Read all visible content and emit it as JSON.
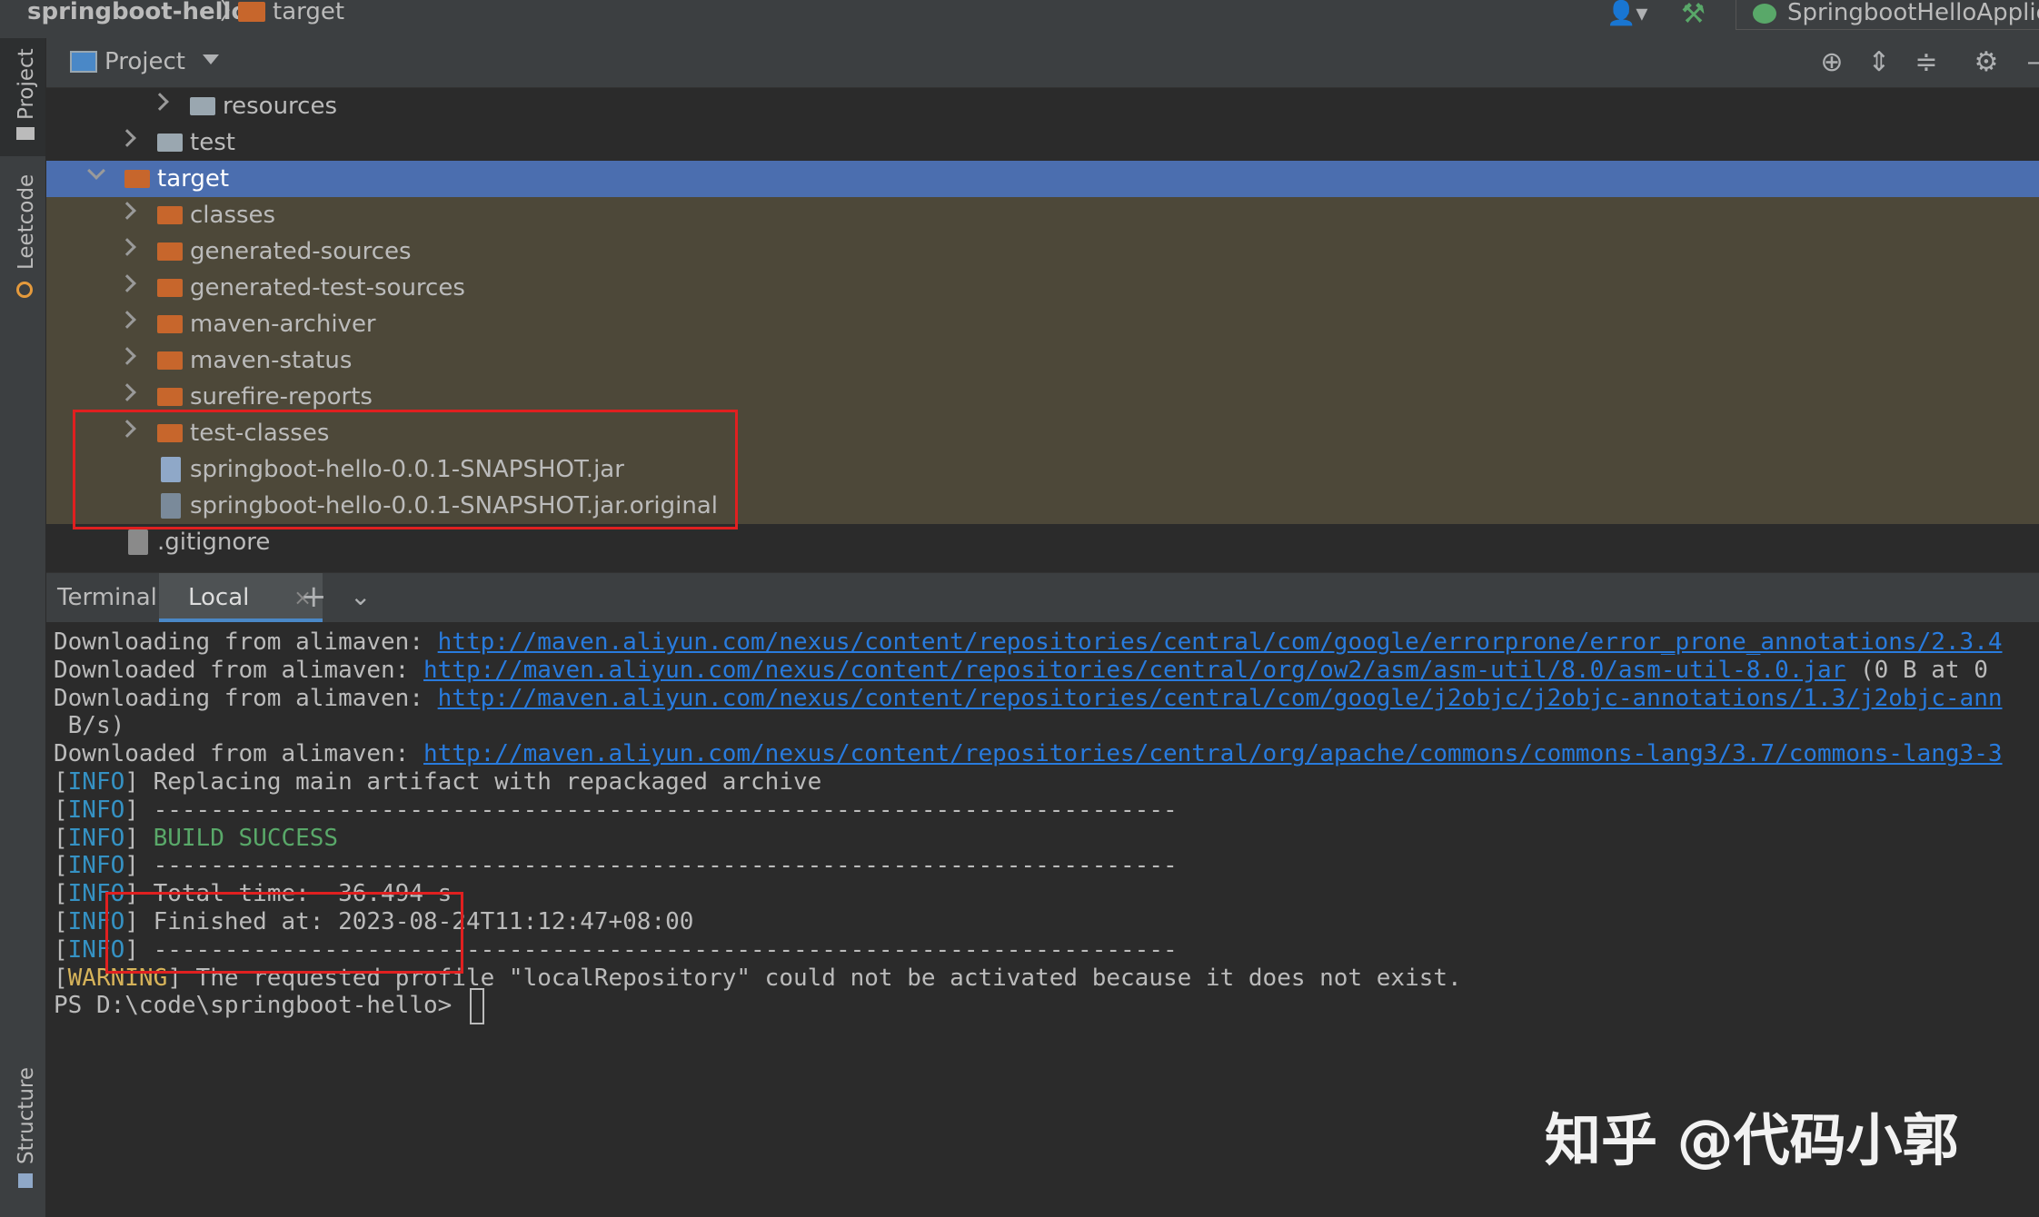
{
  "navbar": {
    "project_name": "springboot-hello",
    "separator": "〉",
    "current_folder": "target",
    "run_config": "SpringbootHelloApplicat"
  },
  "tool_strip": {
    "project": "Project",
    "leetcode": "Leetcode",
    "structure": "Structure"
  },
  "project_panel": {
    "title": "Project",
    "tree": [
      {
        "label": "resources"
      },
      {
        "label": "test"
      },
      {
        "label": "target"
      },
      {
        "label": "classes"
      },
      {
        "label": "generated-sources"
      },
      {
        "label": "generated-test-sources"
      },
      {
        "label": "maven-archiver"
      },
      {
        "label": "maven-status"
      },
      {
        "label": "surefire-reports"
      },
      {
        "label": "test-classes"
      },
      {
        "label": "springboot-hello-0.0.1-SNAPSHOT.jar"
      },
      {
        "label": "springboot-hello-0.0.1-SNAPSHOT.jar.original"
      },
      {
        "label": ".gitignore"
      }
    ]
  },
  "terminal": {
    "label": "Terminal:",
    "tab": "Local",
    "lines": [
      {
        "prefix": "Downloading from alimaven: ",
        "url": "http://maven.aliyun.com/nexus/content/repositories/central/com/google/errorprone/error_prone_annotations/2.3.4"
      },
      {
        "prefix": "Downloaded from alimaven: ",
        "url": "http://maven.aliyun.com/nexus/content/repositories/central/org/ow2/asm/asm-util/8.0/asm-util-8.0.jar",
        "suffix": " (0 B at 0"
      },
      {
        "prefix": "Downloading from alimaven: ",
        "url": "http://maven.aliyun.com/nexus/content/repositories/central/com/google/j2objc/j2objc-annotations/1.3/j2objc-ann"
      },
      {
        "text": " B/s)"
      },
      {
        "prefix": "Downloaded from alimaven: ",
        "url": "http://maven.aliyun.com/nexus/content/repositories/central/org/apache/commons/commons-lang3/3.7/commons-lang3-3"
      },
      {
        "tag": "INFO",
        "text": " Replacing main artifact with repackaged archive"
      },
      {
        "tag": "INFO",
        "text": " ------------------------------------------------------------------------"
      },
      {
        "tag": "INFO",
        "success": "BUILD SUCCESS"
      },
      {
        "tag": "INFO",
        "text": " ------------------------------------------------------------------------"
      },
      {
        "tag": "INFO",
        "text": " Total time:  36.494 s"
      },
      {
        "tag": "INFO",
        "text": " Finished at: 2023-08-24T11:12:47+08:00"
      },
      {
        "tag": "INFO",
        "text": " ------------------------------------------------------------------------"
      },
      {
        "tag": "WARNING",
        "text": " The requested profile \"localRepository\" could not be activated because it does not exist."
      }
    ],
    "prompt": "PS D:\\code\\springboot-hello> "
  },
  "watermark": "知乎 @代码小郭",
  "colors": {
    "selection": "#4b6eaf",
    "excluded_folder_bg": "#4d4839",
    "link": "#287bde",
    "info_tag": "#3592c4",
    "warning_tag": "#d6b35a",
    "success": "#59a869",
    "highlight_box": "#e02020"
  },
  "icons": {
    "folder": "folder-icon",
    "jar": "jar-file-icon",
    "settings": "gear-icon",
    "locate": "target-icon"
  }
}
